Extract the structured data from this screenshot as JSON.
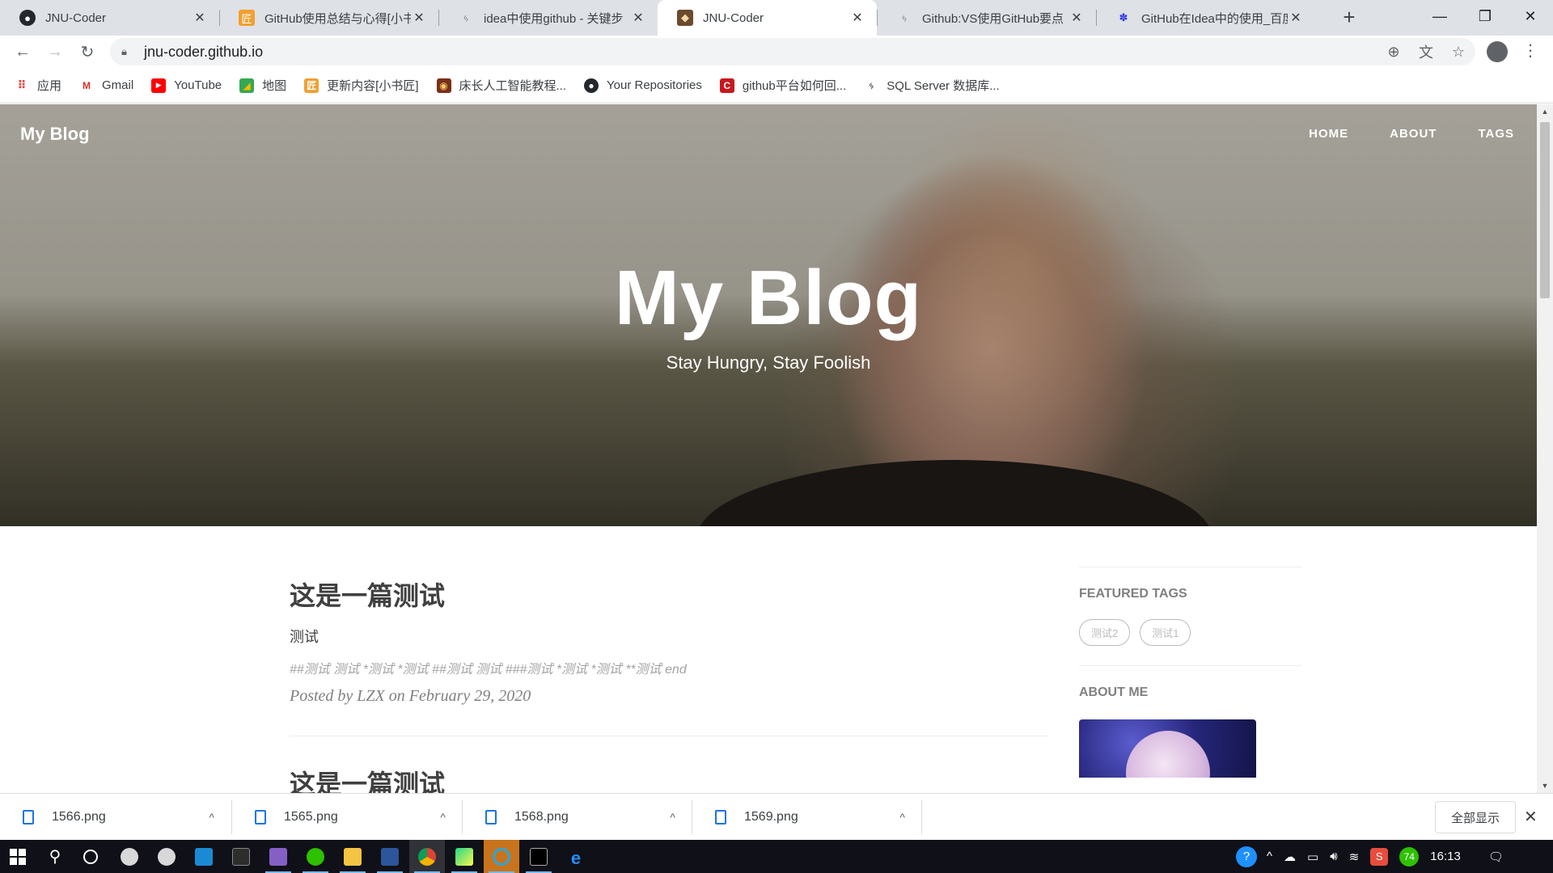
{
  "browser": {
    "tabs": [
      {
        "title": "JNU-Coder",
        "icon": "github-icon",
        "active": false
      },
      {
        "title": "GitHub使用总结与心得[小书",
        "icon": "xiaoshujiang-icon",
        "active": false
      },
      {
        "title": "idea中使用github - 关键步",
        "icon": "feather-icon",
        "active": false
      },
      {
        "title": "JNU-Coder",
        "icon": "blog-avatar-icon",
        "active": true
      },
      {
        "title": "Github:VS使用GitHub要点",
        "icon": "feather-icon",
        "active": false
      },
      {
        "title": "GitHub在Idea中的使用_百度",
        "icon": "baidu-icon",
        "active": false
      }
    ],
    "new_tab": "+",
    "window_controls": {
      "minimize": "—",
      "restore": "❐",
      "close": "✕"
    },
    "url": "jnu-coder.github.io",
    "bookmarks": [
      {
        "label": "应用",
        "icon": "apps-grid-icon"
      },
      {
        "label": "Gmail",
        "icon": "gmail-icon"
      },
      {
        "label": "YouTube",
        "icon": "youtube-icon"
      },
      {
        "label": "地图",
        "icon": "maps-icon"
      },
      {
        "label": "更新内容[小书匠]",
        "icon": "xiaoshujiang-icon"
      },
      {
        "label": "床长人工智能教程...",
        "icon": "tutorial-icon"
      },
      {
        "label": "Your Repositories",
        "icon": "github-icon"
      },
      {
        "label": "github平台如何回...",
        "icon": "csdn-icon"
      },
      {
        "label": "SQL Server 数据库...",
        "icon": "feather-icon"
      }
    ]
  },
  "site": {
    "brand": "My Blog",
    "nav": [
      "HOME",
      "ABOUT",
      "TAGS"
    ],
    "hero_title": "My Blog",
    "hero_subtitle": "Stay Hungry, Stay Foolish"
  },
  "posts": [
    {
      "title": "这是一篇测试",
      "subtitle": "测试",
      "excerpt": "##测试 测试 *测试 *测试 ##测试 测试 ###测试 *测试 *测试 **测试 end",
      "meta": "Posted by LZX on February 29, 2020"
    },
    {
      "title": "这是一篇测试"
    }
  ],
  "sidebar": {
    "featured_tags_heading": "FEATURED TAGS",
    "tags": [
      "测试2",
      "测试1"
    ],
    "about_heading": "ABOUT ME"
  },
  "downloads": {
    "items": [
      "1566.png",
      "1565.png",
      "1568.png",
      "1569.png"
    ],
    "show_all": "全部显示",
    "close": "✕"
  },
  "taskbar": {
    "apps": [
      "start-icon",
      "search-icon",
      "cortana-icon",
      "app-icon",
      "app-icon",
      "mail-icon",
      "terminal-icon",
      "visual-studio-icon",
      "wechat-icon",
      "file-explorer-icon",
      "word-icon",
      "chrome-icon",
      "pycharm-icon",
      "app-icon",
      "console-icon",
      "edge-icon"
    ],
    "battery_badge": "74",
    "clock": "16:13"
  }
}
